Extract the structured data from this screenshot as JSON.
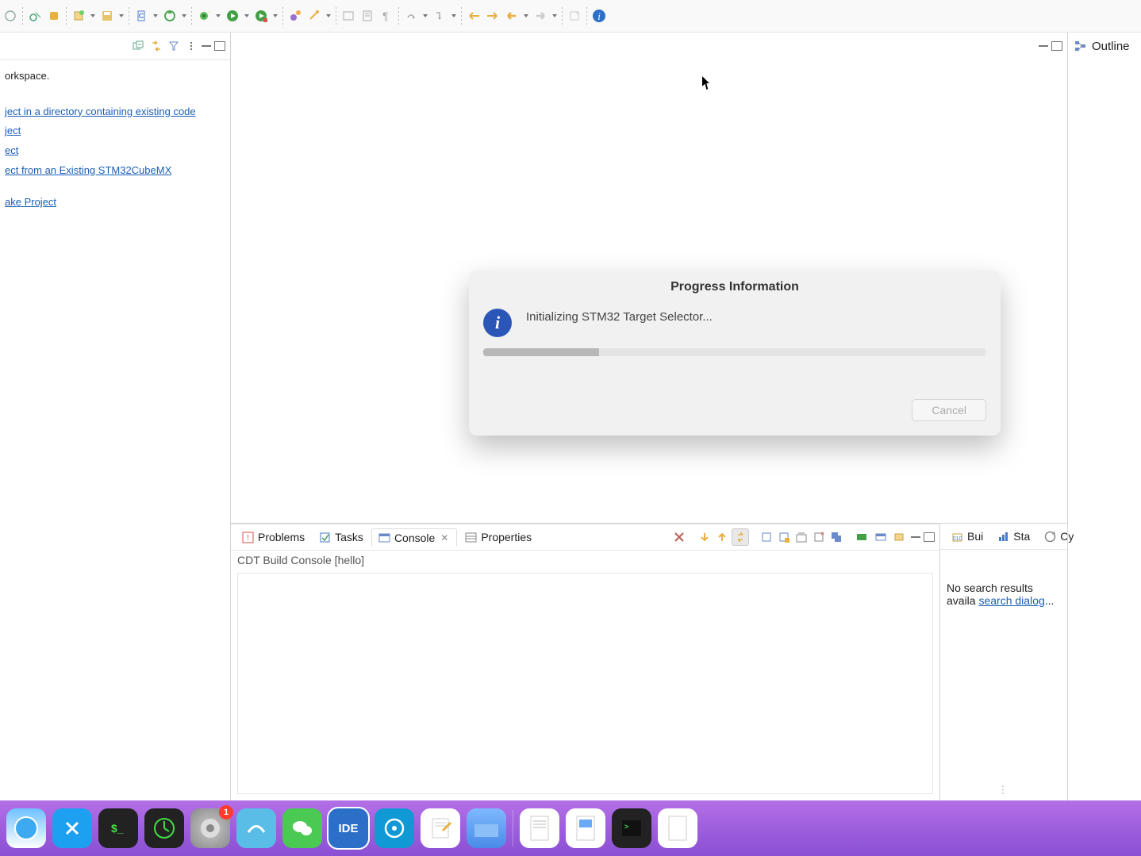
{
  "toolbar": {
    "buttons": [
      "open-perspective",
      "skip-breakpoints",
      "new-menu",
      "save-menu",
      "build-config-menu",
      "build-all-menu",
      "debug-menu",
      "run-menu",
      "run-last-menu",
      "new-c-element",
      "search",
      "open-type",
      "toggle-mark",
      "step-over-menu",
      "step-into-menu",
      "step-return",
      "back",
      "forward",
      "nav-back-menu",
      "nav-forward-menu",
      "pin",
      "info"
    ]
  },
  "left": {
    "heading": "orkspace.",
    "links": [
      "ject in a directory containing existing code",
      "ject",
      "ect",
      "ect from an Existing STM32CubeMX ",
      "ake Project"
    ]
  },
  "outline": {
    "label": "Outline"
  },
  "dialog": {
    "title": "Progress Information",
    "message": "Initializing STM32 Target Selector...",
    "progress_percent": 23,
    "cancel": "Cancel"
  },
  "console": {
    "tabs": [
      {
        "label": "Problems",
        "id": "problems"
      },
      {
        "label": "Tasks",
        "id": "tasks"
      },
      {
        "label": "Console",
        "id": "console",
        "active": true,
        "closable": true
      },
      {
        "label": "Properties",
        "id": "properties"
      }
    ],
    "subtitle": "CDT Build Console [hello]"
  },
  "right_bottom": {
    "tabs": [
      {
        "label": "Bui",
        "id": "build"
      },
      {
        "label": "Sta",
        "id": "static"
      },
      {
        "label": "Cy",
        "id": "cyclo"
      }
    ],
    "text_prefix": "No search results availa",
    "link": "search dialog",
    "text_suffix": "..."
  },
  "dock": {
    "items": [
      "safari",
      "xcode",
      "terminal",
      "activity",
      "settings",
      "app1",
      "wechat",
      "ide",
      "app2",
      "textedit",
      "folder",
      "file1",
      "file2",
      "terminal2",
      "file3"
    ],
    "badge_index": 4,
    "badge_count": "1"
  }
}
